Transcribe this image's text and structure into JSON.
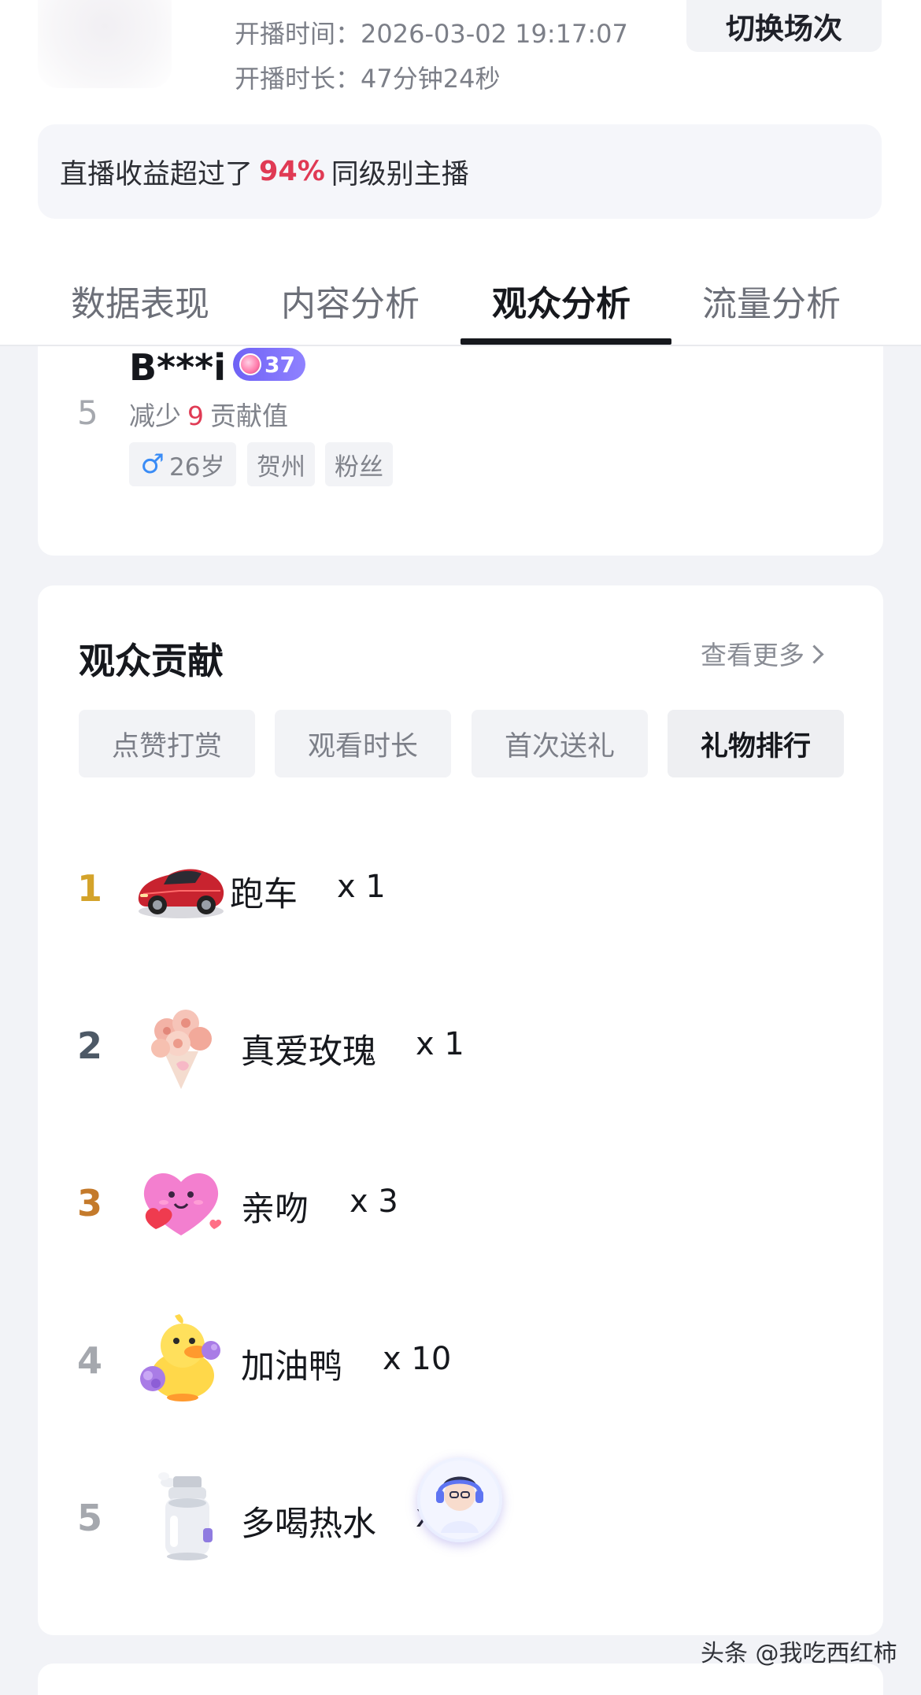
{
  "session": {
    "start_time_label": "开播时间：",
    "start_time_value": "2026-03-02 19:17:07",
    "duration_label": "开播时长：",
    "duration_value": "47分钟24秒",
    "switch_button": "切换场次"
  },
  "income": {
    "prefix": "直播收益超过了",
    "percent": "94%",
    "suffix": "同级别主播"
  },
  "tabs": [
    {
      "label": "数据表现",
      "active": false
    },
    {
      "label": "内容分析",
      "active": false
    },
    {
      "label": "观众分析",
      "active": true
    },
    {
      "label": "流量分析",
      "active": false
    }
  ],
  "audience_entry": {
    "rank": "5",
    "name": "B***i",
    "level": "37",
    "reduce_prefix": "减少",
    "reduce_value": "9",
    "reduce_suffix": "贡献值",
    "tags": {
      "gender_symbol": "♂",
      "age": "26岁",
      "city": "贺州",
      "type": "粉丝"
    }
  },
  "contribution": {
    "title": "观众贡献",
    "view_more": "查看更多",
    "sub_tabs": [
      {
        "label": "点赞打赏",
        "active": false
      },
      {
        "label": "观看时长",
        "active": false
      },
      {
        "label": "首次送礼",
        "active": false
      },
      {
        "label": "礼物排行",
        "active": true
      }
    ],
    "gifts": [
      {
        "rank": "1",
        "name": "跑车",
        "count": "x 1",
        "icon": "sports-car-icon"
      },
      {
        "rank": "2",
        "name": "真爱玫瑰",
        "count": "x 1",
        "icon": "rose-bouquet-icon"
      },
      {
        "rank": "3",
        "name": "亲吻",
        "count": "x 3",
        "icon": "heart-kiss-icon"
      },
      {
        "rank": "4",
        "name": "加油鸭",
        "count": "x 10",
        "icon": "cheer-duck-icon"
      },
      {
        "rank": "5",
        "name": "多喝热水",
        "count": "x",
        "icon": "thermos-icon"
      }
    ]
  },
  "watermark": "头条 @我吃西红柿",
  "colors": {
    "accent_red": "#e03a54",
    "rank1_gold": "#d4a32a",
    "rank3_bronze": "#c47a2b",
    "level_badge": "#7a6df7"
  }
}
